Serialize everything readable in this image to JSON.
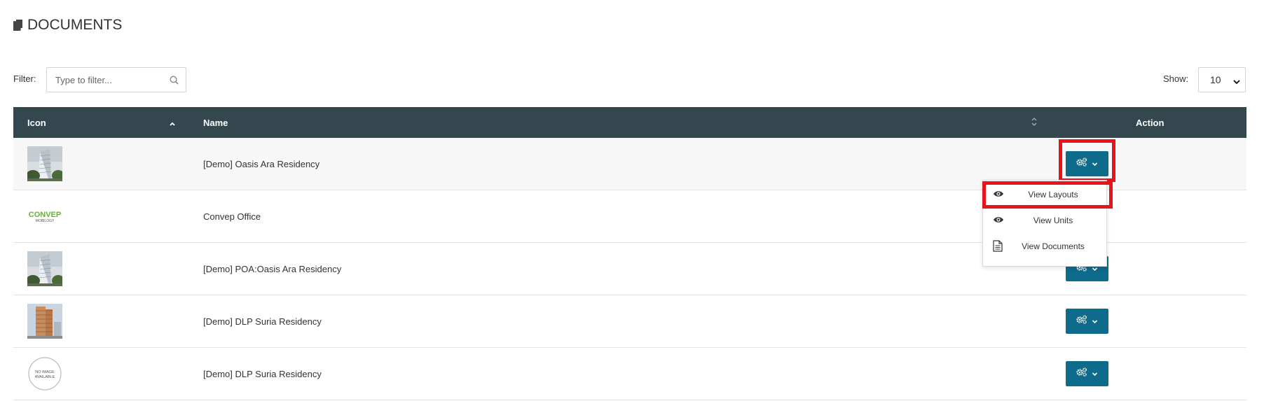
{
  "page": {
    "title": "DOCUMENTS",
    "title_icon": "documents-icon"
  },
  "filter": {
    "label": "Filter:",
    "placeholder": "Type to filter...",
    "value": ""
  },
  "show": {
    "label": "Show:",
    "selected": "10"
  },
  "table": {
    "columns": [
      "Icon",
      "Name",
      "Action"
    ],
    "sort_column": "Icon",
    "sort_direction": "ascending",
    "rows": [
      {
        "thumbnail": "building-photo",
        "name": "[Demo] Oasis Ara Residency"
      },
      {
        "thumbnail": "convep-logo",
        "logo_text_main": "CONVEP",
        "logo_text_sub": "MOBILOGY",
        "name": "Convep Office"
      },
      {
        "thumbnail": "building-photo",
        "name": "[Demo] POA:Oasis Ara Residency"
      },
      {
        "thumbnail": "tower-photo",
        "name": "[Demo] DLP Suria Residency"
      },
      {
        "thumbnail": "no-image-placeholder",
        "placeholder_text": [
          "NO IMAGE",
          "AVAILABLE"
        ],
        "name": "[Demo] DLP Suria Residency"
      }
    ]
  },
  "action_dropdown": {
    "open_on_row": 0,
    "items": [
      {
        "label": "View Layouts",
        "icon": "eye-icon",
        "highlighted": true
      },
      {
        "label": "View Units",
        "icon": "eye-icon",
        "highlighted": false
      },
      {
        "label": "View Documents",
        "icon": "document-icon",
        "highlighted": false
      }
    ]
  },
  "colors": {
    "header_bg": "#34474f",
    "action_button": "#0d6b8c",
    "highlight": "#e8141c",
    "logo_green": "#5cb82e"
  }
}
